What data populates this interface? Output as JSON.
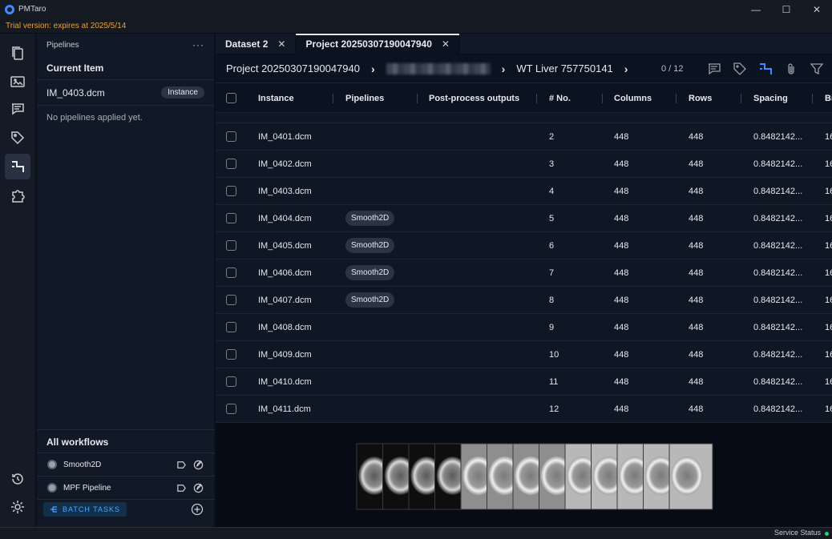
{
  "app": {
    "title": "PMTaro",
    "trial_notice": "Trial version: expires at 2025/5/14"
  },
  "window_controls": [
    "minimize",
    "maximize",
    "close"
  ],
  "activity_bar": {
    "items": [
      {
        "icon": "files-icon",
        "active": false
      },
      {
        "icon": "image-viewer-icon",
        "active": false
      },
      {
        "icon": "comments-icon",
        "active": false
      },
      {
        "icon": "tags-icon",
        "active": false
      },
      {
        "icon": "pipeline-icon",
        "active": true
      },
      {
        "icon": "extensions-icon",
        "active": false
      }
    ],
    "bottom_items": [
      {
        "icon": "history-icon"
      },
      {
        "icon": "settings-icon"
      }
    ]
  },
  "sidepanel": {
    "header": "Pipelines",
    "more": "···",
    "current_item_title": "Current Item",
    "current_item_name": "IM_0403.dcm",
    "current_item_badge": "Instance",
    "empty_note": "No pipelines applied yet.",
    "workflows_title": "All workflows",
    "workflows": [
      {
        "name": "Smooth2D"
      },
      {
        "name": "MPF Pipeline"
      }
    ],
    "batch_label": "BATCH TASKS"
  },
  "tabs": [
    {
      "label": "Dataset 2",
      "active": false
    },
    {
      "label": "Project 20250307190047940",
      "active": true
    }
  ],
  "breadcrumb": {
    "items": [
      "Project 20250307190047940",
      "WT Liver 757750141"
    ],
    "count": "0 / 12"
  },
  "table": {
    "columns": [
      "Instance",
      "Pipelines",
      "Post-process outputs",
      "# No.",
      "Columns",
      "Rows",
      "Spacing",
      "Bi"
    ],
    "rows": [
      {
        "instance": "IM_0401.dcm",
        "pipeline": "",
        "no": "2",
        "columns": "448",
        "rows": "448",
        "spacing": "0.8482142...",
        "extra": "16"
      },
      {
        "instance": "IM_0402.dcm",
        "pipeline": "",
        "no": "3",
        "columns": "448",
        "rows": "448",
        "spacing": "0.8482142...",
        "extra": "16"
      },
      {
        "instance": "IM_0403.dcm",
        "pipeline": "",
        "no": "4",
        "columns": "448",
        "rows": "448",
        "spacing": "0.8482142...",
        "extra": "16"
      },
      {
        "instance": "IM_0404.dcm",
        "pipeline": "Smooth2D",
        "no": "5",
        "columns": "448",
        "rows": "448",
        "spacing": "0.8482142...",
        "extra": "16"
      },
      {
        "instance": "IM_0405.dcm",
        "pipeline": "Smooth2D",
        "no": "6",
        "columns": "448",
        "rows": "448",
        "spacing": "0.8482142...",
        "extra": "16"
      },
      {
        "instance": "IM_0406.dcm",
        "pipeline": "Smooth2D",
        "no": "7",
        "columns": "448",
        "rows": "448",
        "spacing": "0.8482142...",
        "extra": "16"
      },
      {
        "instance": "IM_0407.dcm",
        "pipeline": "Smooth2D",
        "no": "8",
        "columns": "448",
        "rows": "448",
        "spacing": "0.8482142...",
        "extra": "16"
      },
      {
        "instance": "IM_0408.dcm",
        "pipeline": "",
        "no": "9",
        "columns": "448",
        "rows": "448",
        "spacing": "0.8482142...",
        "extra": "16"
      },
      {
        "instance": "IM_0409.dcm",
        "pipeline": "",
        "no": "10",
        "columns": "448",
        "rows": "448",
        "spacing": "0.8482142...",
        "extra": "16"
      },
      {
        "instance": "IM_0410.dcm",
        "pipeline": "",
        "no": "11",
        "columns": "448",
        "rows": "448",
        "spacing": "0.8482142...",
        "extra": "16"
      },
      {
        "instance": "IM_0411.dcm",
        "pipeline": "",
        "no": "12",
        "columns": "448",
        "rows": "448",
        "spacing": "0.8482142...",
        "extra": "16"
      }
    ]
  },
  "status_bar": {
    "label": "Service Status",
    "status_color": "#2ecc71"
  },
  "colors": {
    "accent": "#3d8bfd",
    "trial": "#e9a23b",
    "batch": "#4da3ff"
  }
}
